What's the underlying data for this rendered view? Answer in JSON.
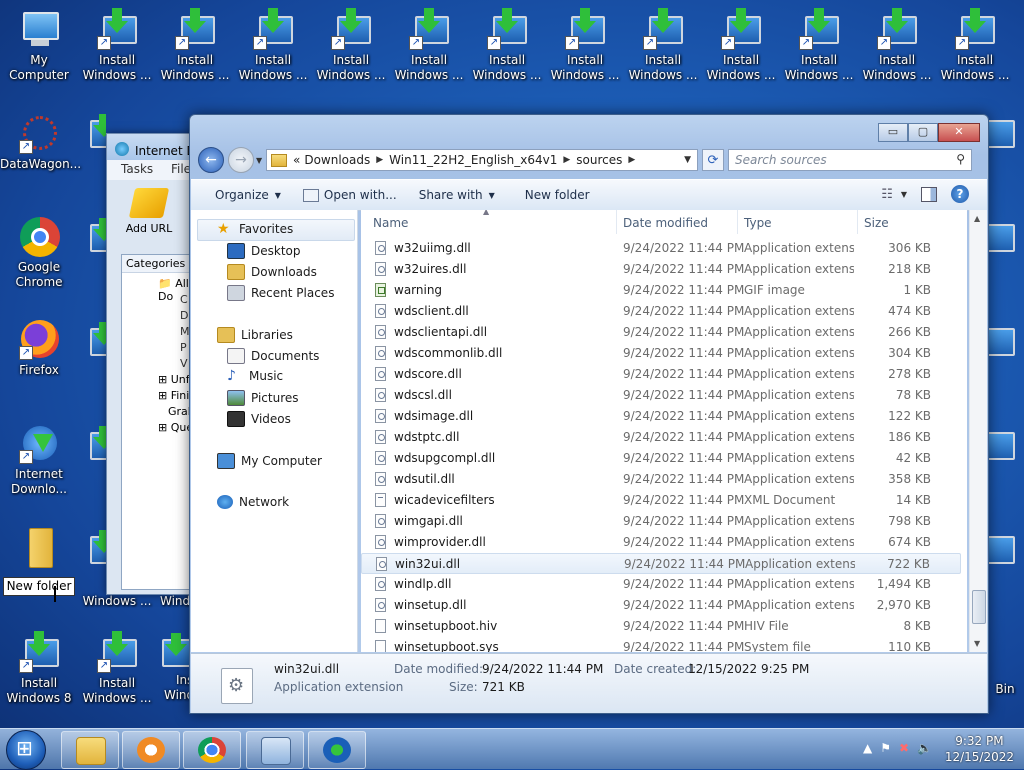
{
  "desktop": {
    "my_computer": "My Computer",
    "datawagon": "DataWagon...",
    "chrome": [
      "Google",
      "Chrome"
    ],
    "firefox": "Firefox",
    "idm": [
      "Internet",
      "Downlo..."
    ],
    "new_folder": "New folder",
    "install_top": [
      "Install",
      "Windows ..."
    ],
    "install_w8": [
      "Install",
      "Windows 8"
    ],
    "install_w": [
      "Install",
      "Windows ..."
    ],
    "partial_labels": {
      "windows_dots": "Windows ...",
      "win": "Wind",
      "bin": "Bin"
    }
  },
  "idm_window": {
    "title": "Internet Do",
    "menu_tasks": "Tasks",
    "menu_file": "File",
    "add_url": "Add URL",
    "categories": "Categories",
    "tree": [
      "All Do",
      "C",
      "D",
      "M",
      "P",
      "V",
      "Unfin",
      "Finish",
      "Grabb",
      "Queu"
    ]
  },
  "explorer": {
    "window_buttons": {
      "min": "▭",
      "max": "▢",
      "close": "✕"
    },
    "address": {
      "prefix": "«",
      "crumbs": [
        "Downloads",
        "Win11_22H2_English_x64v1",
        "sources"
      ]
    },
    "search_placeholder": "Search sources",
    "toolbar": {
      "organize": "Organize",
      "open_with": "Open with...",
      "share_with": "Share with",
      "new_folder": "New folder"
    },
    "nav": {
      "favorites": "Favorites",
      "desktop": "Desktop",
      "downloads": "Downloads",
      "recent": "Recent Places",
      "libraries": "Libraries",
      "documents": "Documents",
      "music": "Music",
      "pictures": "Pictures",
      "videos": "Videos",
      "my_computer": "My Computer",
      "network": "Network"
    },
    "columns": {
      "name": "Name",
      "date": "Date modified",
      "type": "Type",
      "size": "Size"
    },
    "files": [
      {
        "name": "w32uiimg.dll",
        "date": "9/24/2022 11:44 PM",
        "type": "Application extens...",
        "size": "306 KB",
        "icon": "dll"
      },
      {
        "name": "w32uires.dll",
        "date": "9/24/2022 11:44 PM",
        "type": "Application extens...",
        "size": "218 KB",
        "icon": "dll"
      },
      {
        "name": "warning",
        "date": "9/24/2022 11:44 PM",
        "type": "GIF image",
        "size": "1 KB",
        "icon": "gif"
      },
      {
        "name": "wdsclient.dll",
        "date": "9/24/2022 11:44 PM",
        "type": "Application extens...",
        "size": "474 KB",
        "icon": "dll"
      },
      {
        "name": "wdsclientapi.dll",
        "date": "9/24/2022 11:44 PM",
        "type": "Application extens...",
        "size": "266 KB",
        "icon": "dll"
      },
      {
        "name": "wdscommonlib.dll",
        "date": "9/24/2022 11:44 PM",
        "type": "Application extens...",
        "size": "304 KB",
        "icon": "dll"
      },
      {
        "name": "wdscore.dll",
        "date": "9/24/2022 11:44 PM",
        "type": "Application extens...",
        "size": "278 KB",
        "icon": "dll"
      },
      {
        "name": "wdscsl.dll",
        "date": "9/24/2022 11:44 PM",
        "type": "Application extens...",
        "size": "78 KB",
        "icon": "dll"
      },
      {
        "name": "wdsimage.dll",
        "date": "9/24/2022 11:44 PM",
        "type": "Application extens...",
        "size": "122 KB",
        "icon": "dll"
      },
      {
        "name": "wdstptc.dll",
        "date": "9/24/2022 11:44 PM",
        "type": "Application extens...",
        "size": "186 KB",
        "icon": "dll"
      },
      {
        "name": "wdsupgcompl.dll",
        "date": "9/24/2022 11:44 PM",
        "type": "Application extens...",
        "size": "42 KB",
        "icon": "dll"
      },
      {
        "name": "wdsutil.dll",
        "date": "9/24/2022 11:44 PM",
        "type": "Application extens...",
        "size": "358 KB",
        "icon": "dll"
      },
      {
        "name": "wicadevicefilters",
        "date": "9/24/2022 11:44 PM",
        "type": "XML Document",
        "size": "14 KB",
        "icon": "xml"
      },
      {
        "name": "wimgapi.dll",
        "date": "9/24/2022 11:44 PM",
        "type": "Application extens...",
        "size": "798 KB",
        "icon": "dll"
      },
      {
        "name": "wimprovider.dll",
        "date": "9/24/2022 11:44 PM",
        "type": "Application extens...",
        "size": "674 KB",
        "icon": "dll"
      },
      {
        "name": "win32ui.dll",
        "date": "9/24/2022 11:44 PM",
        "type": "Application extens...",
        "size": "722 KB",
        "icon": "dll",
        "selected": true
      },
      {
        "name": "windlp.dll",
        "date": "9/24/2022 11:44 PM",
        "type": "Application extens...",
        "size": "1,494 KB",
        "icon": "dll"
      },
      {
        "name": "winsetup.dll",
        "date": "9/24/2022 11:44 PM",
        "type": "Application extens...",
        "size": "2,970 KB",
        "icon": "dll"
      },
      {
        "name": "winsetupboot.hiv",
        "date": "9/24/2022 11:44 PM",
        "type": "HIV File",
        "size": "8 KB",
        "icon": "plain"
      },
      {
        "name": "winsetupboot.sys",
        "date": "9/24/2022 11:44 PM",
        "type": "System file",
        "size": "110 KB",
        "icon": "plain"
      }
    ],
    "details": {
      "name": "win32ui.dll",
      "type": "Application extension",
      "modified_label": "Date modified:",
      "modified": "9/24/2022 11:44 PM",
      "created_label": "Date created:",
      "created": "12/15/2022 9:25 PM",
      "size_label": "Size:",
      "size": "721 KB"
    }
  },
  "taskbar": {
    "time": "9:32 PM",
    "date": "12/15/2022"
  }
}
